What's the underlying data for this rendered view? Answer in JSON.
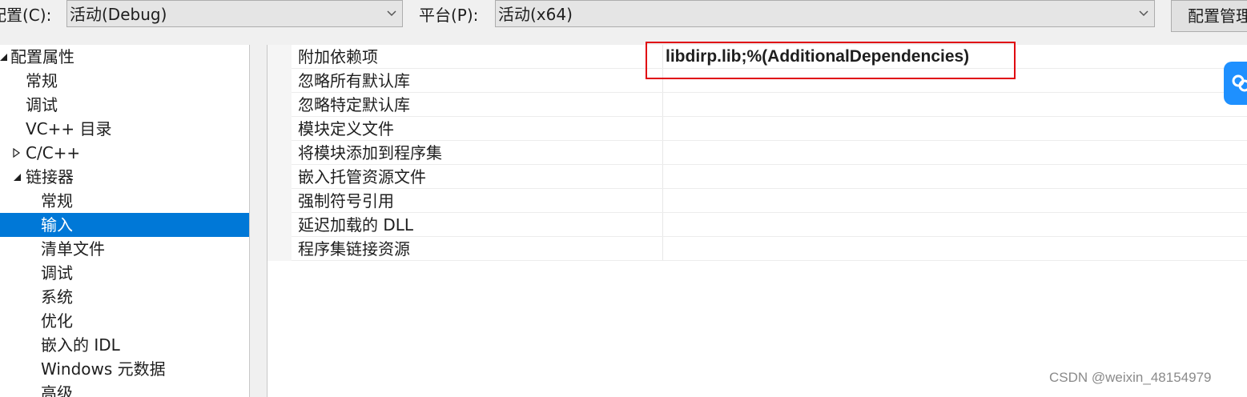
{
  "toolbar": {
    "config_label": "配置(C):",
    "config_value": "活动(Debug)",
    "platform_label": "平台(P):",
    "platform_value": "活动(x64)",
    "manager_button": "配置管理"
  },
  "tree": {
    "items": [
      {
        "label": "配置属性",
        "expander": "expanded-triangle"
      },
      {
        "label": "常规"
      },
      {
        "label": "调试"
      },
      {
        "label": "VC++ 目录"
      },
      {
        "label": "C/C++",
        "expander": "collapsed-triangle"
      },
      {
        "label": "链接器",
        "expander": "expanded-triangle"
      },
      {
        "label": "常规"
      },
      {
        "label": "输入",
        "selected": true
      },
      {
        "label": "清单文件"
      },
      {
        "label": "调试"
      },
      {
        "label": "系统"
      },
      {
        "label": "优化"
      },
      {
        "label": "嵌入的 IDL"
      },
      {
        "label": "Windows 元数据"
      },
      {
        "label": "高级"
      }
    ]
  },
  "grid": {
    "rows": [
      {
        "name": "附加依赖项",
        "value": "libdirp.lib;%(AdditionalDependencies)"
      },
      {
        "name": "忽略所有默认库",
        "value": ""
      },
      {
        "name": "忽略特定默认库",
        "value": ""
      },
      {
        "name": "模块定义文件",
        "value": ""
      },
      {
        "name": "将模块添加到程序集",
        "value": ""
      },
      {
        "name": "嵌入托管资源文件",
        "value": ""
      },
      {
        "name": "强制符号引用",
        "value": ""
      },
      {
        "name": "延迟加载的 DLL",
        "value": ""
      },
      {
        "name": "程序集链接资源",
        "value": ""
      }
    ]
  },
  "watermark": "CSDN @weixin_48154979",
  "colors": {
    "selection": "#0078d7",
    "highlight_border": "#e0000f",
    "float_button": "#1e90ff"
  }
}
